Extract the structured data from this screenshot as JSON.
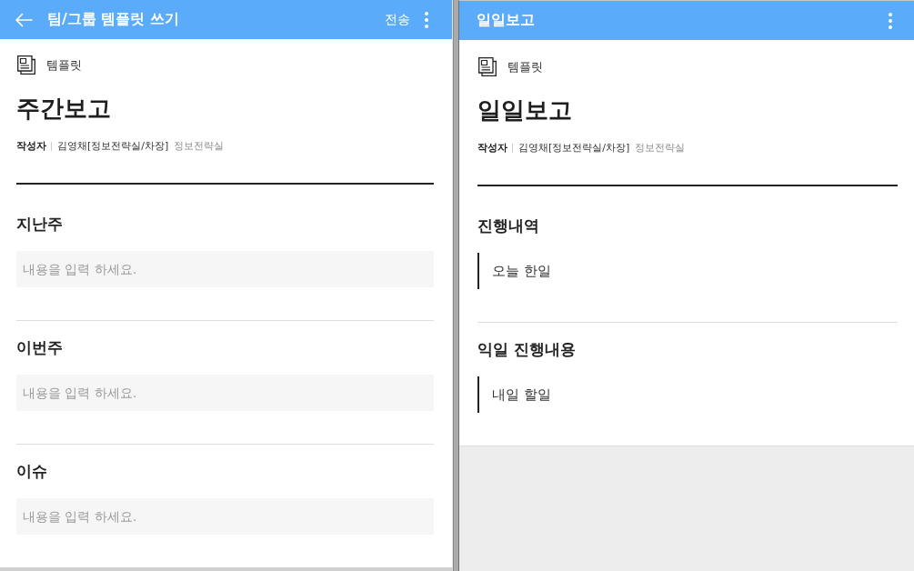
{
  "panels": [
    {
      "header": {
        "back": true,
        "title": "팀/그룹 템플릿 쓰기",
        "action": "전송"
      },
      "template_label": "템플릿",
      "title": "주간보고",
      "author": {
        "label": "작성자",
        "name": "김영채[정보전략실/차장]",
        "department": "정보전략실"
      },
      "sections": [
        {
          "kind": "field",
          "heading": "지난주",
          "placeholder": "내용을 입력 하세요."
        },
        {
          "kind": "field",
          "heading": "이번주",
          "placeholder": "내용을 입력 하세요."
        },
        {
          "kind": "field",
          "heading": "이슈",
          "placeholder": "내용을 입력 하세요."
        }
      ]
    },
    {
      "header": {
        "back": false,
        "title": "일일보고"
      },
      "template_label": "템플릿",
      "title": "일일보고",
      "author": {
        "label": "작성자",
        "name": "김영채[정보전략실/차장]",
        "department": "정보전략실"
      },
      "sections": [
        {
          "kind": "quote",
          "heading": "진행내역",
          "text": "오늘 한일"
        },
        {
          "kind": "quote",
          "heading": "익일 진행내용",
          "text": "내일 할일"
        }
      ]
    }
  ]
}
